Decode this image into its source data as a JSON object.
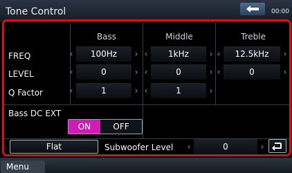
{
  "title": "Tone Control",
  "clock": "00:00",
  "columns": {
    "bass": "Bass",
    "middle": "Middle",
    "treble": "Treble"
  },
  "rows": {
    "freq": {
      "label": "FREQ",
      "bass": "100Hz",
      "middle": "1kHz",
      "treble": "12.5kHz"
    },
    "level": {
      "label": "LEVEL",
      "bass": "0",
      "middle": "0",
      "treble": "0"
    },
    "qfactor": {
      "label": "Q Factor",
      "bass": "1",
      "middle": "1"
    }
  },
  "bass_dc_ext": {
    "label": "Bass DC EXT",
    "on": "ON",
    "off": "OFF",
    "state": "on"
  },
  "flat_label": "Flat",
  "subwoofer": {
    "label": "Subwoofer Level",
    "value": "0"
  },
  "menu_label": "Menu",
  "colors": {
    "frame": "#d8101a",
    "toggle_on": "#d11bb5"
  }
}
